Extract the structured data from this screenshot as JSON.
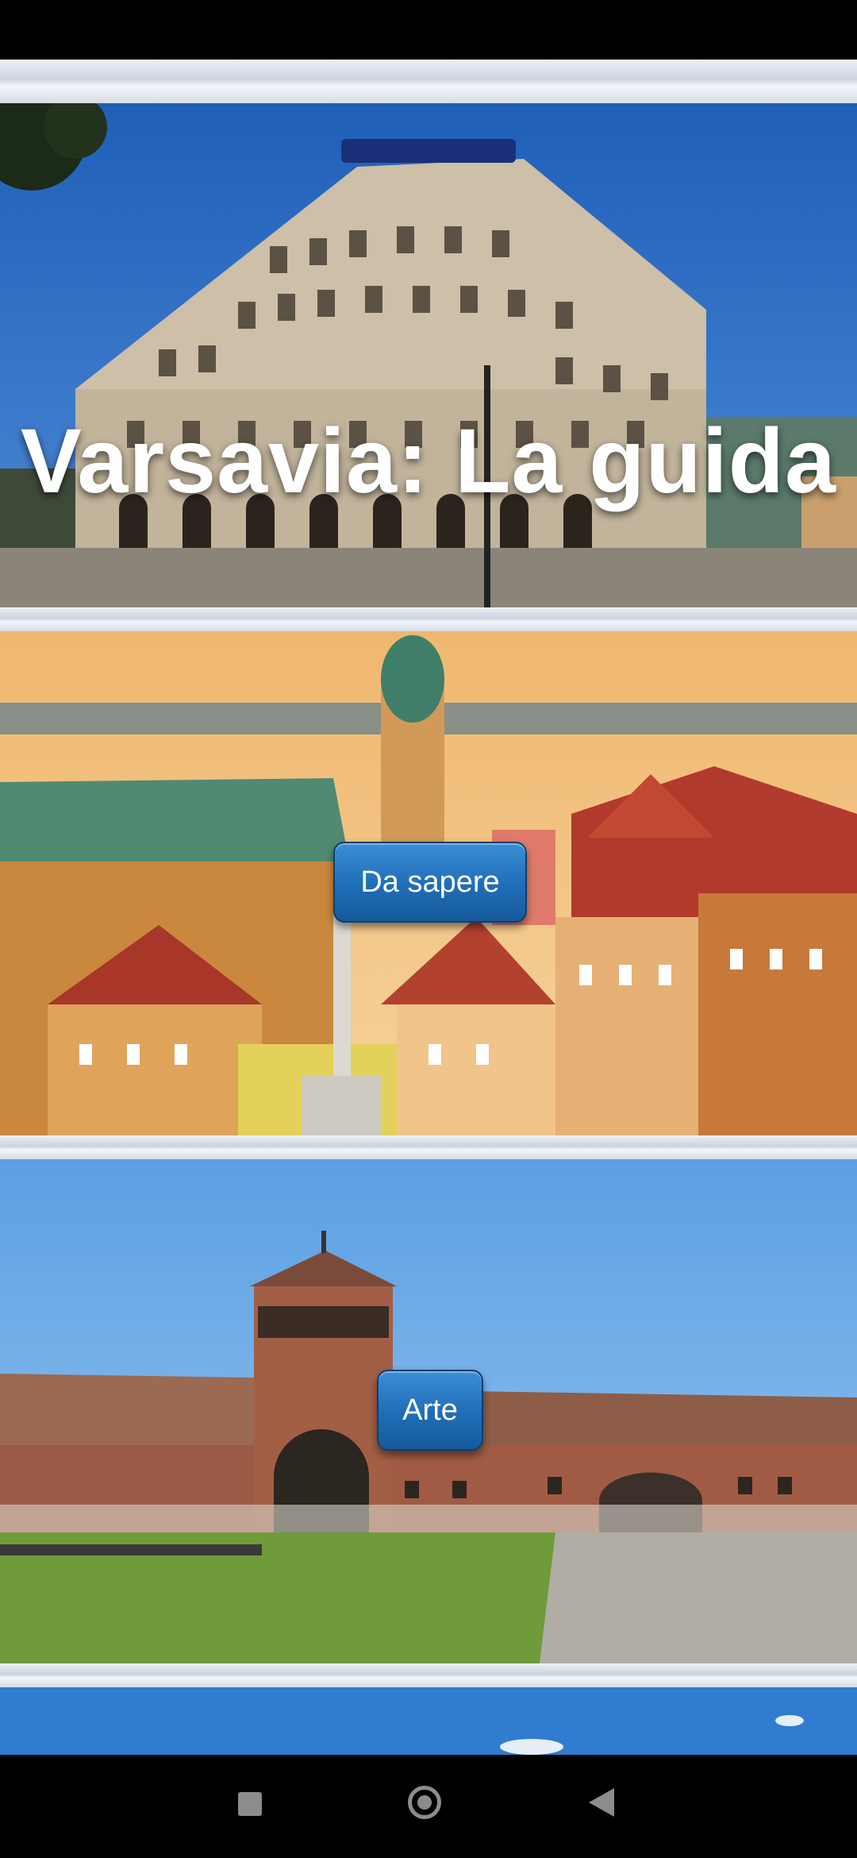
{
  "header": {
    "title": "Varsavia: La guida"
  },
  "sections": [
    {
      "button_label": "Da sapere"
    },
    {
      "button_label": "Arte"
    }
  ],
  "navigation": {
    "recents_icon": "square-icon",
    "home_icon": "circle-home-icon",
    "back_icon": "triangle-back-icon"
  }
}
